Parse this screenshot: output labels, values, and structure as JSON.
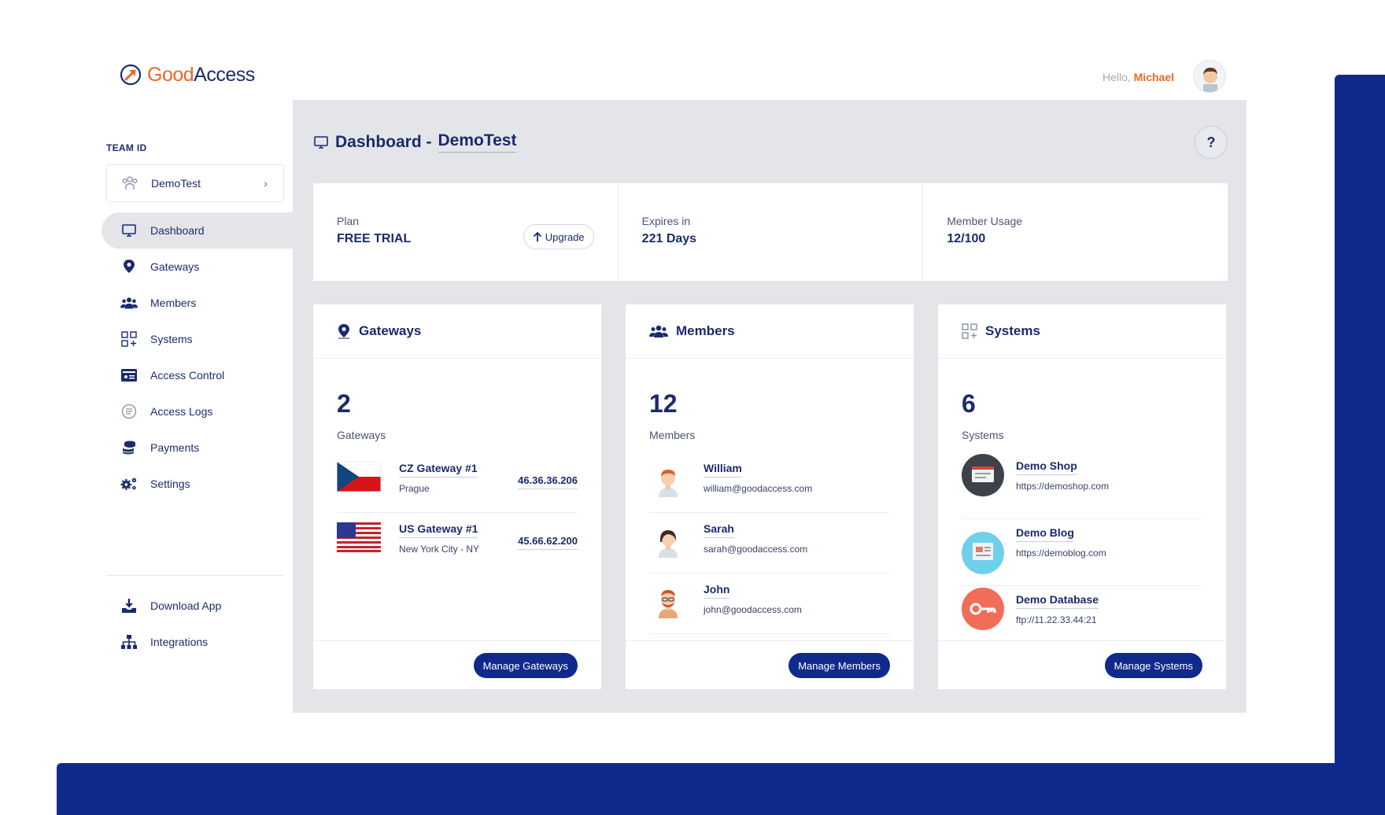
{
  "brand": {
    "good": "Good",
    "access": "Access",
    "accent": "#e8682b",
    "primary": "#10298c"
  },
  "header": {
    "greeting": "Hello,",
    "user_name": "Michael"
  },
  "sidebar": {
    "team_label": "TEAM ID",
    "team_name": "DemoTest",
    "items": [
      {
        "label": "Dashboard",
        "icon": "monitor-icon"
      },
      {
        "label": "Gateways",
        "icon": "location-pin-icon"
      },
      {
        "label": "Members",
        "icon": "users-icon"
      },
      {
        "label": "Systems",
        "icon": "grid-plus-icon"
      },
      {
        "label": "Access Control",
        "icon": "id-card-icon"
      },
      {
        "label": "Access Logs",
        "icon": "list-circle-icon"
      },
      {
        "label": "Payments",
        "icon": "coins-icon"
      },
      {
        "label": "Settings",
        "icon": "gears-icon"
      }
    ],
    "secondary": [
      {
        "label": "Download App",
        "icon": "download-icon"
      },
      {
        "label": "Integrations",
        "icon": "sitemap-icon"
      }
    ]
  },
  "main": {
    "title_prefix": "Dashboard -",
    "title_team": "DemoTest",
    "help": "?",
    "plan": {
      "label": "Plan",
      "value": "FREE TRIAL",
      "upgrade_label": "Upgrade",
      "expires_label": "Expires in",
      "expires_value": "221 Days",
      "usage_label": "Member Usage",
      "usage_value": "12/100"
    },
    "gateways": {
      "title": "Gateways",
      "count": "2",
      "sub": "Gateways",
      "rows": [
        {
          "name": "CZ Gateway #1",
          "city": "Prague",
          "ip": "46.36.36.206"
        },
        {
          "name": "US Gateway #1",
          "city": "New York City - NY",
          "ip": "45.66.62.200"
        }
      ],
      "button": "Manage Gateways"
    },
    "members": {
      "title": "Members",
      "count": "12",
      "sub": "Members",
      "rows": [
        {
          "name": "William",
          "email": "william@goodaccess.com"
        },
        {
          "name": "Sarah",
          "email": "sarah@goodaccess.com"
        },
        {
          "name": "John",
          "email": "john@goodaccess.com"
        }
      ],
      "button": "Manage Members"
    },
    "systems": {
      "title": "Systems",
      "count": "6",
      "sub": "Systems",
      "rows": [
        {
          "name": "Demo Shop",
          "url": "https://demoshop.com"
        },
        {
          "name": "Demo Blog",
          "url": "https://demoblog.com"
        },
        {
          "name": "Demo Database",
          "url": "ftp://11.22.33.44:21"
        }
      ],
      "button": "Manage Systems"
    }
  }
}
